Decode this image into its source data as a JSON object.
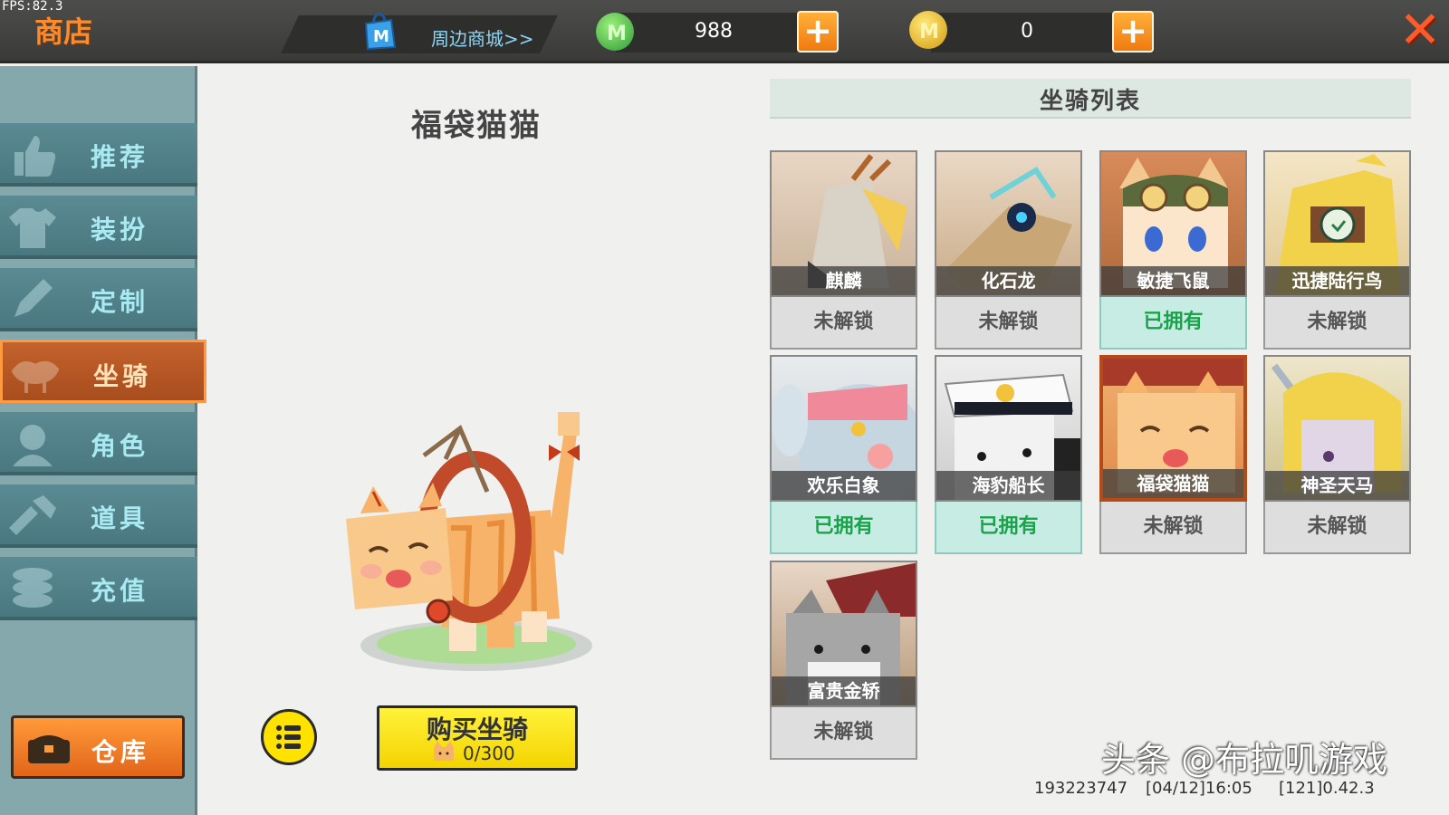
{
  "fps": "FPS:82.3",
  "header": {
    "title": "商店",
    "mall_link": "周边商城>>",
    "currency_m": "988",
    "currency_coin": "0"
  },
  "sidebar": {
    "items": [
      {
        "label": "推荐",
        "icon": "thumbs-up-icon"
      },
      {
        "label": "装扮",
        "icon": "shirt-icon"
      },
      {
        "label": "定制",
        "icon": "pencil-icon"
      },
      {
        "label": "坐骑",
        "icon": "saddle-icon"
      },
      {
        "label": "角色",
        "icon": "character-icon"
      },
      {
        "label": "道具",
        "icon": "tool-icon"
      },
      {
        "label": "充值",
        "icon": "coins-icon"
      }
    ],
    "warehouse_label": "仓库"
  },
  "preview": {
    "mount_name": "福袋猫猫",
    "buy_label": "购买坐骑",
    "buy_count": "0/300"
  },
  "mount_list": {
    "title": "坐骑列表",
    "mounts": [
      {
        "name": "麒麟",
        "status": "未解锁",
        "owned": false
      },
      {
        "name": "化石龙",
        "status": "未解锁",
        "owned": false
      },
      {
        "name": "敏捷飞鼠",
        "status": "已拥有",
        "owned": true
      },
      {
        "name": "迅捷陆行鸟",
        "status": "未解锁",
        "owned": false
      },
      {
        "name": "欢乐白象",
        "status": "已拥有",
        "owned": true
      },
      {
        "name": "海豹船长",
        "status": "已拥有",
        "owned": true
      },
      {
        "name": "福袋猫猫",
        "status": "未解锁",
        "owned": false
      },
      {
        "name": "神圣天马",
        "status": "未解锁",
        "owned": false
      },
      {
        "name": "富贵金轿",
        "status": "未解锁",
        "owned": false
      }
    ]
  },
  "watermark": "头条 @布拉叽游戏",
  "footer": {
    "uid": "193223747",
    "datetime": "[04/12]16:05",
    "version": "[121]0.42.3"
  },
  "colors": {
    "accent_orange": "#f07a10",
    "sidebar_teal": "#4a7880",
    "owned_green": "#1aa34a",
    "buy_yellow": "#f4d400"
  }
}
